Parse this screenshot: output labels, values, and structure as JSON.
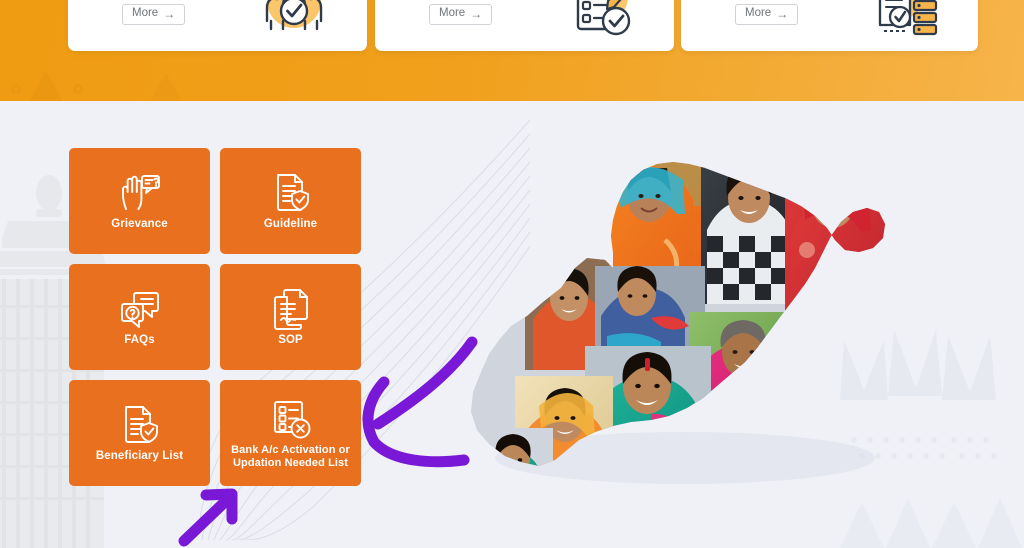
{
  "theme": {
    "banner_orange": "#efa01d",
    "tile_orange": "#e8701e",
    "page_background": "#eff1f7",
    "annotation_purple": "#7a18d8",
    "card_white": "#ffffff",
    "tile_label_color": "#ffffff"
  },
  "banner": {
    "cards": [
      {
        "id": "card-1",
        "more_label": "More",
        "more_arrow": "→",
        "icon": "group-people-check-icon"
      },
      {
        "id": "card-2",
        "more_label": "More",
        "more_arrow": "→",
        "icon": "clipboard-checklist-check-icon"
      },
      {
        "id": "card-3",
        "more_label": "More",
        "more_arrow": "→",
        "icon": "document-gear-server-icon"
      }
    ]
  },
  "tiles": [
    {
      "label": "Grievance",
      "icon": "hand-question-bubble-icon",
      "two_line": false
    },
    {
      "label": "Guideline",
      "icon": "document-shield-check-icon",
      "two_line": false
    },
    {
      "label": "FAQs",
      "icon": "chat-bubbles-question-icon",
      "two_line": false
    },
    {
      "label": "SOP",
      "icon": "documents-signature-icon",
      "two_line": false
    },
    {
      "label": "Beneficiary List",
      "icon": "list-shield-check-icon",
      "two_line": false
    },
    {
      "label": "Bank A/c Activation or Updation Needed List",
      "icon": "checklist-x-circle-icon",
      "two_line": true
    }
  ],
  "map": {
    "name": "odisha-state-map-photo-collage",
    "description": "Map of Odisha filled with a collage of photographs of smiling women in colourful saris"
  },
  "annotations": [
    {
      "name": "purple-arrow-pointing-to-bank-account-tile",
      "color": "#7a18d8",
      "direction": "left"
    },
    {
      "name": "purple-arrow-pointing-to-beneficiary-list-tile",
      "color": "#7a18d8",
      "direction": "up-right"
    }
  ],
  "watermarks": [
    {
      "name": "temple-watermark-left"
    },
    {
      "name": "tribal-pattern-watermark-right"
    },
    {
      "name": "contour-lines-watermark"
    }
  ]
}
